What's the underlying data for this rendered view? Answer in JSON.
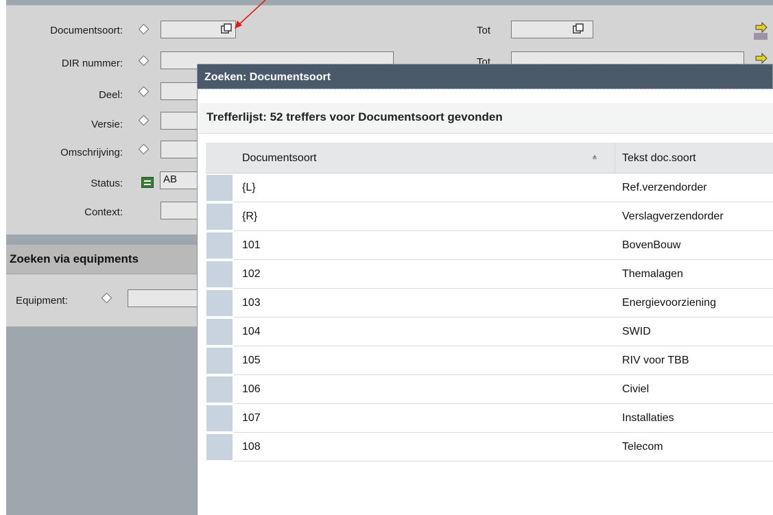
{
  "colors": {
    "background_gray": "#9ea7ad",
    "panel": "#d4d4d4",
    "dialog_title": "#4a5a6a",
    "row_selector": "#c9d3df",
    "status_icon": "#3b7a3b",
    "nav_arrow": "#e8d21a",
    "annotation_arrow": "#e01c1c"
  },
  "form": {
    "documentsoort_label": "Documentsoort:",
    "dir_nummer_label": "DIR nummer:",
    "deel_label": "Deel:",
    "versie_label": "Versie:",
    "omschrijving_label": "Omschrijving:",
    "status_label": "Status:",
    "status_value": "AB",
    "context_label": "Context:",
    "tot_label": "Tot",
    "tot_label_2": "Tot"
  },
  "equipment_section": {
    "title": "Zoeken via equipments",
    "equipment_label": "Equipment:"
  },
  "dialog": {
    "title": "Zoeken: Documentsoort",
    "hit_summary": "Trefferlijst: 52 treffers voor Documentsoort gevonden",
    "columns": [
      "Documentsoort",
      "Tekst doc.soort"
    ],
    "rows": [
      [
        "{L}",
        "Ref.verzendorder"
      ],
      [
        "{R}",
        "Verslagverzendorder"
      ],
      [
        "101",
        "BovenBouw"
      ],
      [
        "102",
        "Themalagen"
      ],
      [
        "103",
        "Energievoorziening"
      ],
      [
        "104",
        "SWID"
      ],
      [
        "105",
        "RIV voor TBB"
      ],
      [
        "106",
        "Civiel"
      ],
      [
        "107",
        "Installaties"
      ],
      [
        "108",
        "Telecom"
      ]
    ]
  },
  "icons": [
    "diamond-icon",
    "value-help-icon",
    "status-equals-icon",
    "forward-arrow-icon",
    "sort-icon",
    "annotation-arrow-icon"
  ]
}
